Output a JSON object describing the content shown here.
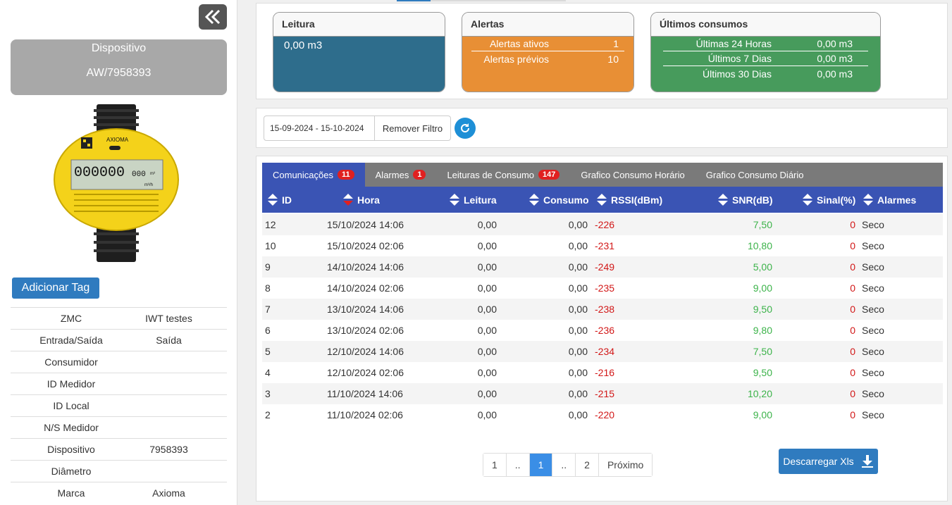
{
  "sidebar": {
    "device_title": "Dispositivo",
    "device_id": "AW/7958393",
    "meter": {
      "brand_text": "AXIOMA",
      "counter": "000000",
      "counter_fraction": "000",
      "unit": "m³",
      "flow_unit": "m³/h"
    },
    "add_tag_label": "Adicionar Tag",
    "properties": [
      {
        "key": "ZMC",
        "value": "IWT testes"
      },
      {
        "key": "Entrada/Saída",
        "value": "Saída"
      },
      {
        "key": "Consumidor",
        "value": ""
      },
      {
        "key": "ID Medidor",
        "value": ""
      },
      {
        "key": "ID Local",
        "value": ""
      },
      {
        "key": "N/S Medidor",
        "value": ""
      },
      {
        "key": "Dispositivo",
        "value": "7958393"
      },
      {
        "key": "Diâmetro",
        "value": ""
      },
      {
        "key": "Marca",
        "value": "Axioma"
      }
    ]
  },
  "summary": {
    "leitura": {
      "title": "Leitura",
      "value": "0,00 m3"
    },
    "alertas": {
      "title": "Alertas",
      "rows": [
        {
          "label": "Alertas ativos",
          "value": "1"
        },
        {
          "label": "Alertas prévios",
          "value": "10"
        }
      ]
    },
    "consumos": {
      "title": "Últimos consumos",
      "rows": [
        {
          "label": "Últimas 24 Horas",
          "value": "0,00 m3"
        },
        {
          "label": "Últimos 7 Dias",
          "value": "0,00 m3"
        },
        {
          "label": "Últimos 30 Dias",
          "value": "0,00 m3"
        }
      ]
    }
  },
  "filter": {
    "date_range": "15-09-2024 - 15-10-2024",
    "remove_label": "Remover Filtro"
  },
  "tabs": [
    {
      "label": "Comunicações",
      "badge": "11",
      "active": true
    },
    {
      "label": "Alarmes",
      "badge": "1",
      "active": false
    },
    {
      "label": "Leituras de Consumo",
      "badge": "147",
      "active": false
    },
    {
      "label": "Grafico Consumo Horário",
      "badge": "",
      "active": false
    },
    {
      "label": "Grafico Consumo Diário",
      "badge": "",
      "active": false
    }
  ],
  "columns": [
    "ID",
    "Hora",
    "Leitura",
    "Consumo",
    "RSSI(dBm)",
    "SNR(dB)",
    "Sinal(%)",
    "Alarmes"
  ],
  "rows": [
    {
      "id": "12",
      "hora": "15/10/2024 14:06",
      "leitura": "0,00",
      "consumo": "0,00",
      "rssi": "-226",
      "snr": "7,50",
      "sinal": "0",
      "alarmes": "Seco"
    },
    {
      "id": "10",
      "hora": "15/10/2024 02:06",
      "leitura": "0,00",
      "consumo": "0,00",
      "rssi": "-231",
      "snr": "10,80",
      "sinal": "0",
      "alarmes": "Seco"
    },
    {
      "id": "9",
      "hora": "14/10/2024 14:06",
      "leitura": "0,00",
      "consumo": "0,00",
      "rssi": "-249",
      "snr": "5,00",
      "sinal": "0",
      "alarmes": "Seco"
    },
    {
      "id": "8",
      "hora": "14/10/2024 02:06",
      "leitura": "0,00",
      "consumo": "0,00",
      "rssi": "-235",
      "snr": "9,00",
      "sinal": "0",
      "alarmes": "Seco"
    },
    {
      "id": "7",
      "hora": "13/10/2024 14:06",
      "leitura": "0,00",
      "consumo": "0,00",
      "rssi": "-238",
      "snr": "9,50",
      "sinal": "0",
      "alarmes": "Seco"
    },
    {
      "id": "6",
      "hora": "13/10/2024 02:06",
      "leitura": "0,00",
      "consumo": "0,00",
      "rssi": "-236",
      "snr": "9,80",
      "sinal": "0",
      "alarmes": "Seco"
    },
    {
      "id": "5",
      "hora": "12/10/2024 14:06",
      "leitura": "0,00",
      "consumo": "0,00",
      "rssi": "-234",
      "snr": "7,50",
      "sinal": "0",
      "alarmes": "Seco"
    },
    {
      "id": "4",
      "hora": "12/10/2024 02:06",
      "leitura": "0,00",
      "consumo": "0,00",
      "rssi": "-216",
      "snr": "9,50",
      "sinal": "0",
      "alarmes": "Seco"
    },
    {
      "id": "3",
      "hora": "11/10/2024 14:06",
      "leitura": "0,00",
      "consumo": "0,00",
      "rssi": "-215",
      "snr": "10,20",
      "sinal": "0",
      "alarmes": "Seco"
    },
    {
      "id": "2",
      "hora": "11/10/2024 02:06",
      "leitura": "0,00",
      "consumo": "0,00",
      "rssi": "-220",
      "snr": "9,00",
      "sinal": "0",
      "alarmes": "Seco"
    }
  ],
  "pagination": {
    "pages": [
      {
        "label": "1",
        "active": false
      },
      {
        "label": "..",
        "active": false
      },
      {
        "label": "1",
        "active": true
      },
      {
        "label": "..",
        "active": false
      },
      {
        "label": "2",
        "active": false
      },
      {
        "label": "Próximo",
        "active": false
      }
    ]
  },
  "download_label": "Descarregar Xls",
  "colors": {
    "primary": "#3a54b4",
    "leitura": "#2e6d8c",
    "alertas": "#e88f35",
    "consumos": "#479b5c",
    "rssi": "#d21818",
    "snr": "#3cb34a",
    "badge": "#e02020"
  },
  "icons": [
    "double-chevron-left-icon",
    "refresh-icon",
    "download-icon",
    "sort-icon"
  ]
}
